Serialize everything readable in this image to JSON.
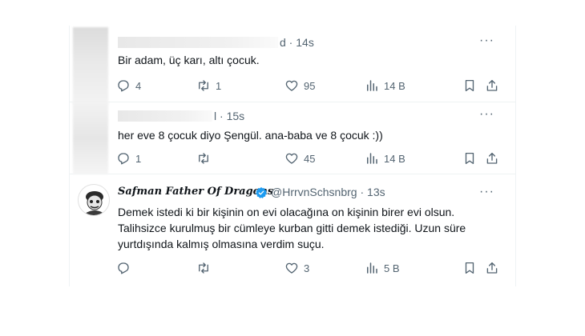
{
  "tweets": [
    {
      "time": "14s",
      "name_tail": "d",
      "text": "Bir adam, üç karı, altı çocuk.",
      "replies": "4",
      "retweets": "1",
      "likes": "95",
      "views": "14 B"
    },
    {
      "time": "15s",
      "name_tail": "l",
      "text": "her eve 8 çocuk diyo Şengül. ana-baba ve 8 çocuk :))",
      "replies": "1",
      "retweets": "",
      "likes": "45",
      "views": "14 B"
    },
    {
      "display_name": "Safman Father Of Dragons",
      "handle": "@HrrvnSchsnbrg",
      "time": "13s",
      "text": "Demek istedi ki bir kişinin on evi olacağına on kişinin birer evi olsun. Talihsizce kurulmuş bir cümleye kurban gitti demek istediği. Uzun süre yurtdışında kalmış olmasına verdim suçu.",
      "replies": "",
      "retweets": "",
      "likes": "3",
      "views": "5 B"
    }
  ],
  "icons": {
    "reply": "reply-icon",
    "retweet": "retweet-icon",
    "like": "heart-icon",
    "views": "views-icon",
    "bookmark": "bookmark-icon",
    "share": "share-icon",
    "more": "more-icon",
    "verified": "verified-badge-icon"
  },
  "colors": {
    "text": "#0f1419",
    "muted": "#536471",
    "verified": "#1d9bf0",
    "divider": "#eff3f4"
  }
}
